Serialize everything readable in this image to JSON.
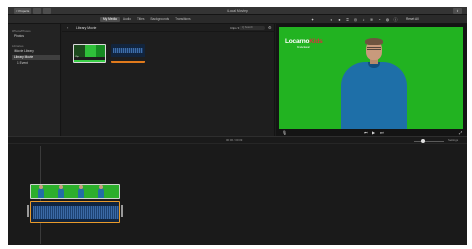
{
  "window": {
    "title": "iLocal Moviep",
    "projects_label": "< Projects",
    "share_label": "⇪"
  },
  "toolbar": {
    "tabs": [
      "My Media",
      "Audio",
      "Titles",
      "Backgrounds",
      "Transitions"
    ],
    "reset_all": "Reset All"
  },
  "sidebar": {
    "heading_library": "iPhoto/Photos",
    "item_photos": "Photos",
    "heading_libraries": "Libraries",
    "library_name": "iMovie Library",
    "library_selected": "Library Movie",
    "library_sub": "1 Event"
  },
  "browser": {
    "title": "Library Movie",
    "filter_label": "Clips ▾",
    "search_placeholder": "Q Search",
    "clip1_label": "Clip"
  },
  "viewer": {
    "logo_main": "Locarno",
    "logo_highlight": "Kids",
    "logo_sub": "Kinderkanal"
  },
  "timeline": {
    "time_label": "00:06 / 00:09",
    "settings_label": "Settings"
  },
  "colors": {
    "green_screen": "#22b321",
    "accent_orange": "#e89a2c",
    "selection_blue": "#3f6fa8"
  }
}
